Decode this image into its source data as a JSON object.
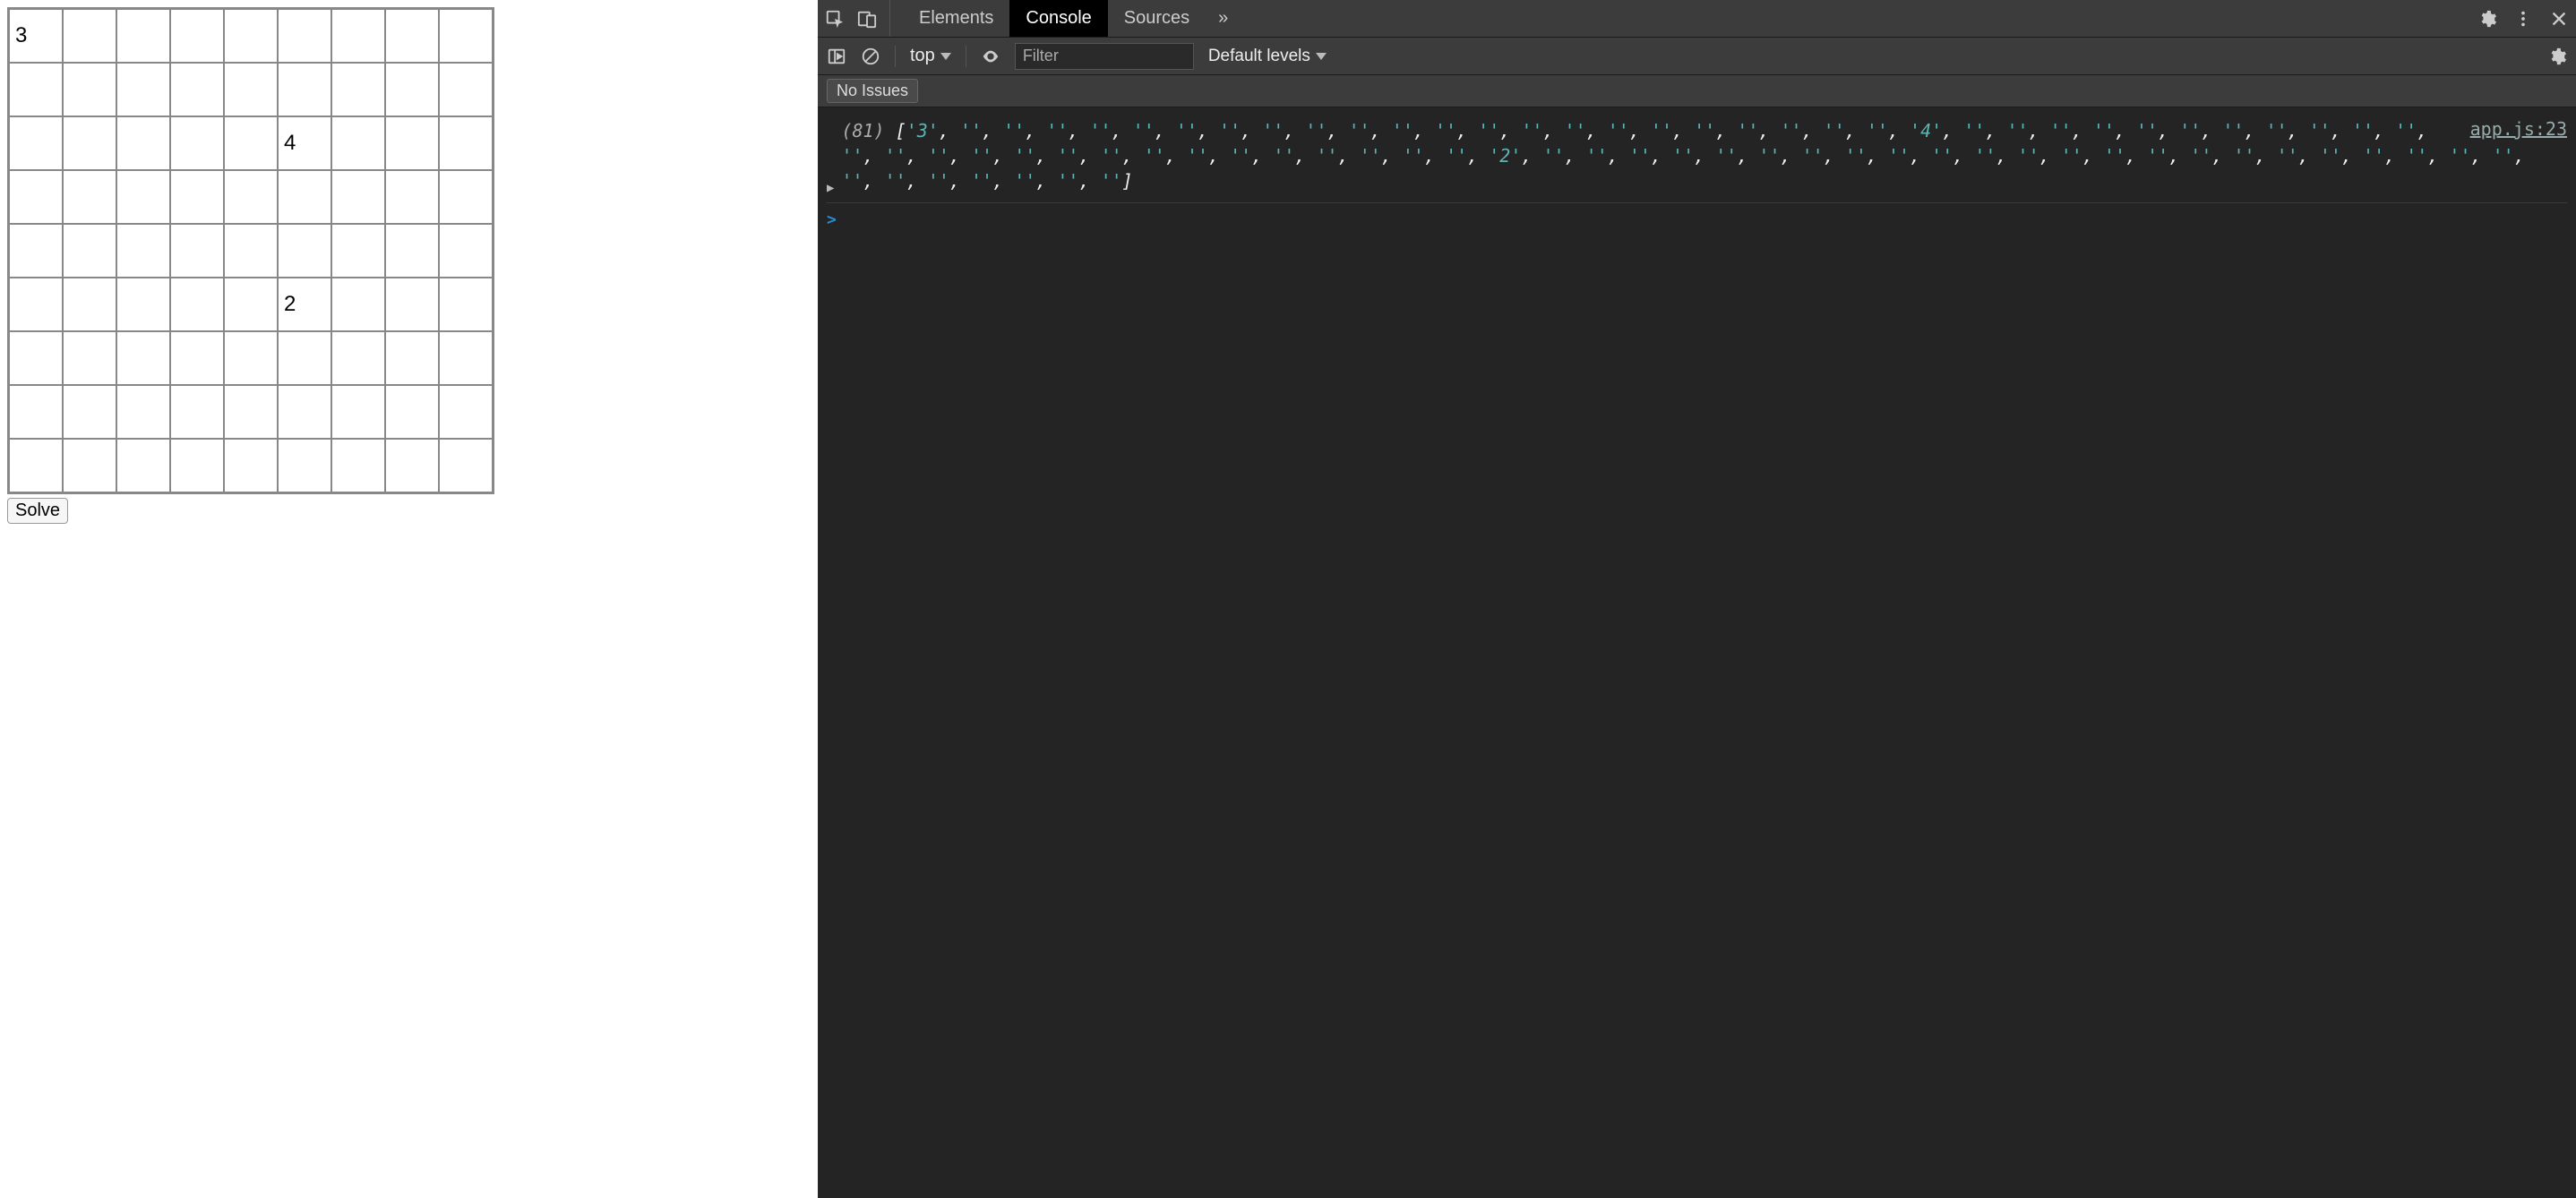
{
  "sudoku": {
    "grid": [
      [
        "3",
        "",
        "",
        "",
        "",
        "",
        "",
        "",
        ""
      ],
      [
        "",
        "",
        "",
        "",
        "",
        "",
        "",
        "",
        ""
      ],
      [
        "",
        "",
        "",
        "",
        "",
        "4",
        "",
        "",
        ""
      ],
      [
        "",
        "",
        "",
        "",
        "",
        "",
        "",
        "",
        ""
      ],
      [
        "",
        "",
        "",
        "",
        "",
        "",
        "",
        "",
        ""
      ],
      [
        "",
        "",
        "",
        "",
        "",
        "2",
        "",
        "",
        ""
      ],
      [
        "",
        "",
        "",
        "",
        "",
        "",
        "",
        "",
        ""
      ],
      [
        "",
        "",
        "",
        "",
        "",
        "",
        "",
        "",
        ""
      ],
      [
        "",
        "",
        "",
        "",
        "",
        "",
        "",
        "",
        ""
      ]
    ],
    "solve_label": "Solve"
  },
  "devtools": {
    "tabs": [
      "Elements",
      "Console",
      "Sources"
    ],
    "active_tab_index": 1,
    "more_label": "»",
    "second_row": {
      "context_label": "top",
      "filter_placeholder": "Filter",
      "filter_value": "",
      "levels_label": "Default levels"
    },
    "issues": {
      "label": "No Issues"
    },
    "console": {
      "log": {
        "source": "app.js:23",
        "count": "(81)",
        "array": [
          "3",
          "",
          "",
          "",
          "",
          "",
          "",
          "",
          "",
          "",
          "",
          "",
          "",
          "",
          "",
          "",
          "",
          "",
          "",
          "",
          "",
          "",
          "",
          "4",
          "",
          "",
          "",
          "",
          "",
          "",
          "",
          "",
          "",
          "",
          "",
          "",
          "",
          "",
          "",
          "",
          "",
          "",
          "",
          "",
          "",
          "",
          "",
          "",
          "",
          "",
          "2",
          "",
          "",
          "",
          "",
          "",
          "",
          "",
          "",
          "",
          "",
          "",
          "",
          "",
          "",
          "",
          "",
          "",
          "",
          "",
          "",
          "",
          "",
          "",
          "",
          "",
          "",
          "",
          "",
          "",
          ""
        ]
      },
      "prompt": ">"
    }
  }
}
